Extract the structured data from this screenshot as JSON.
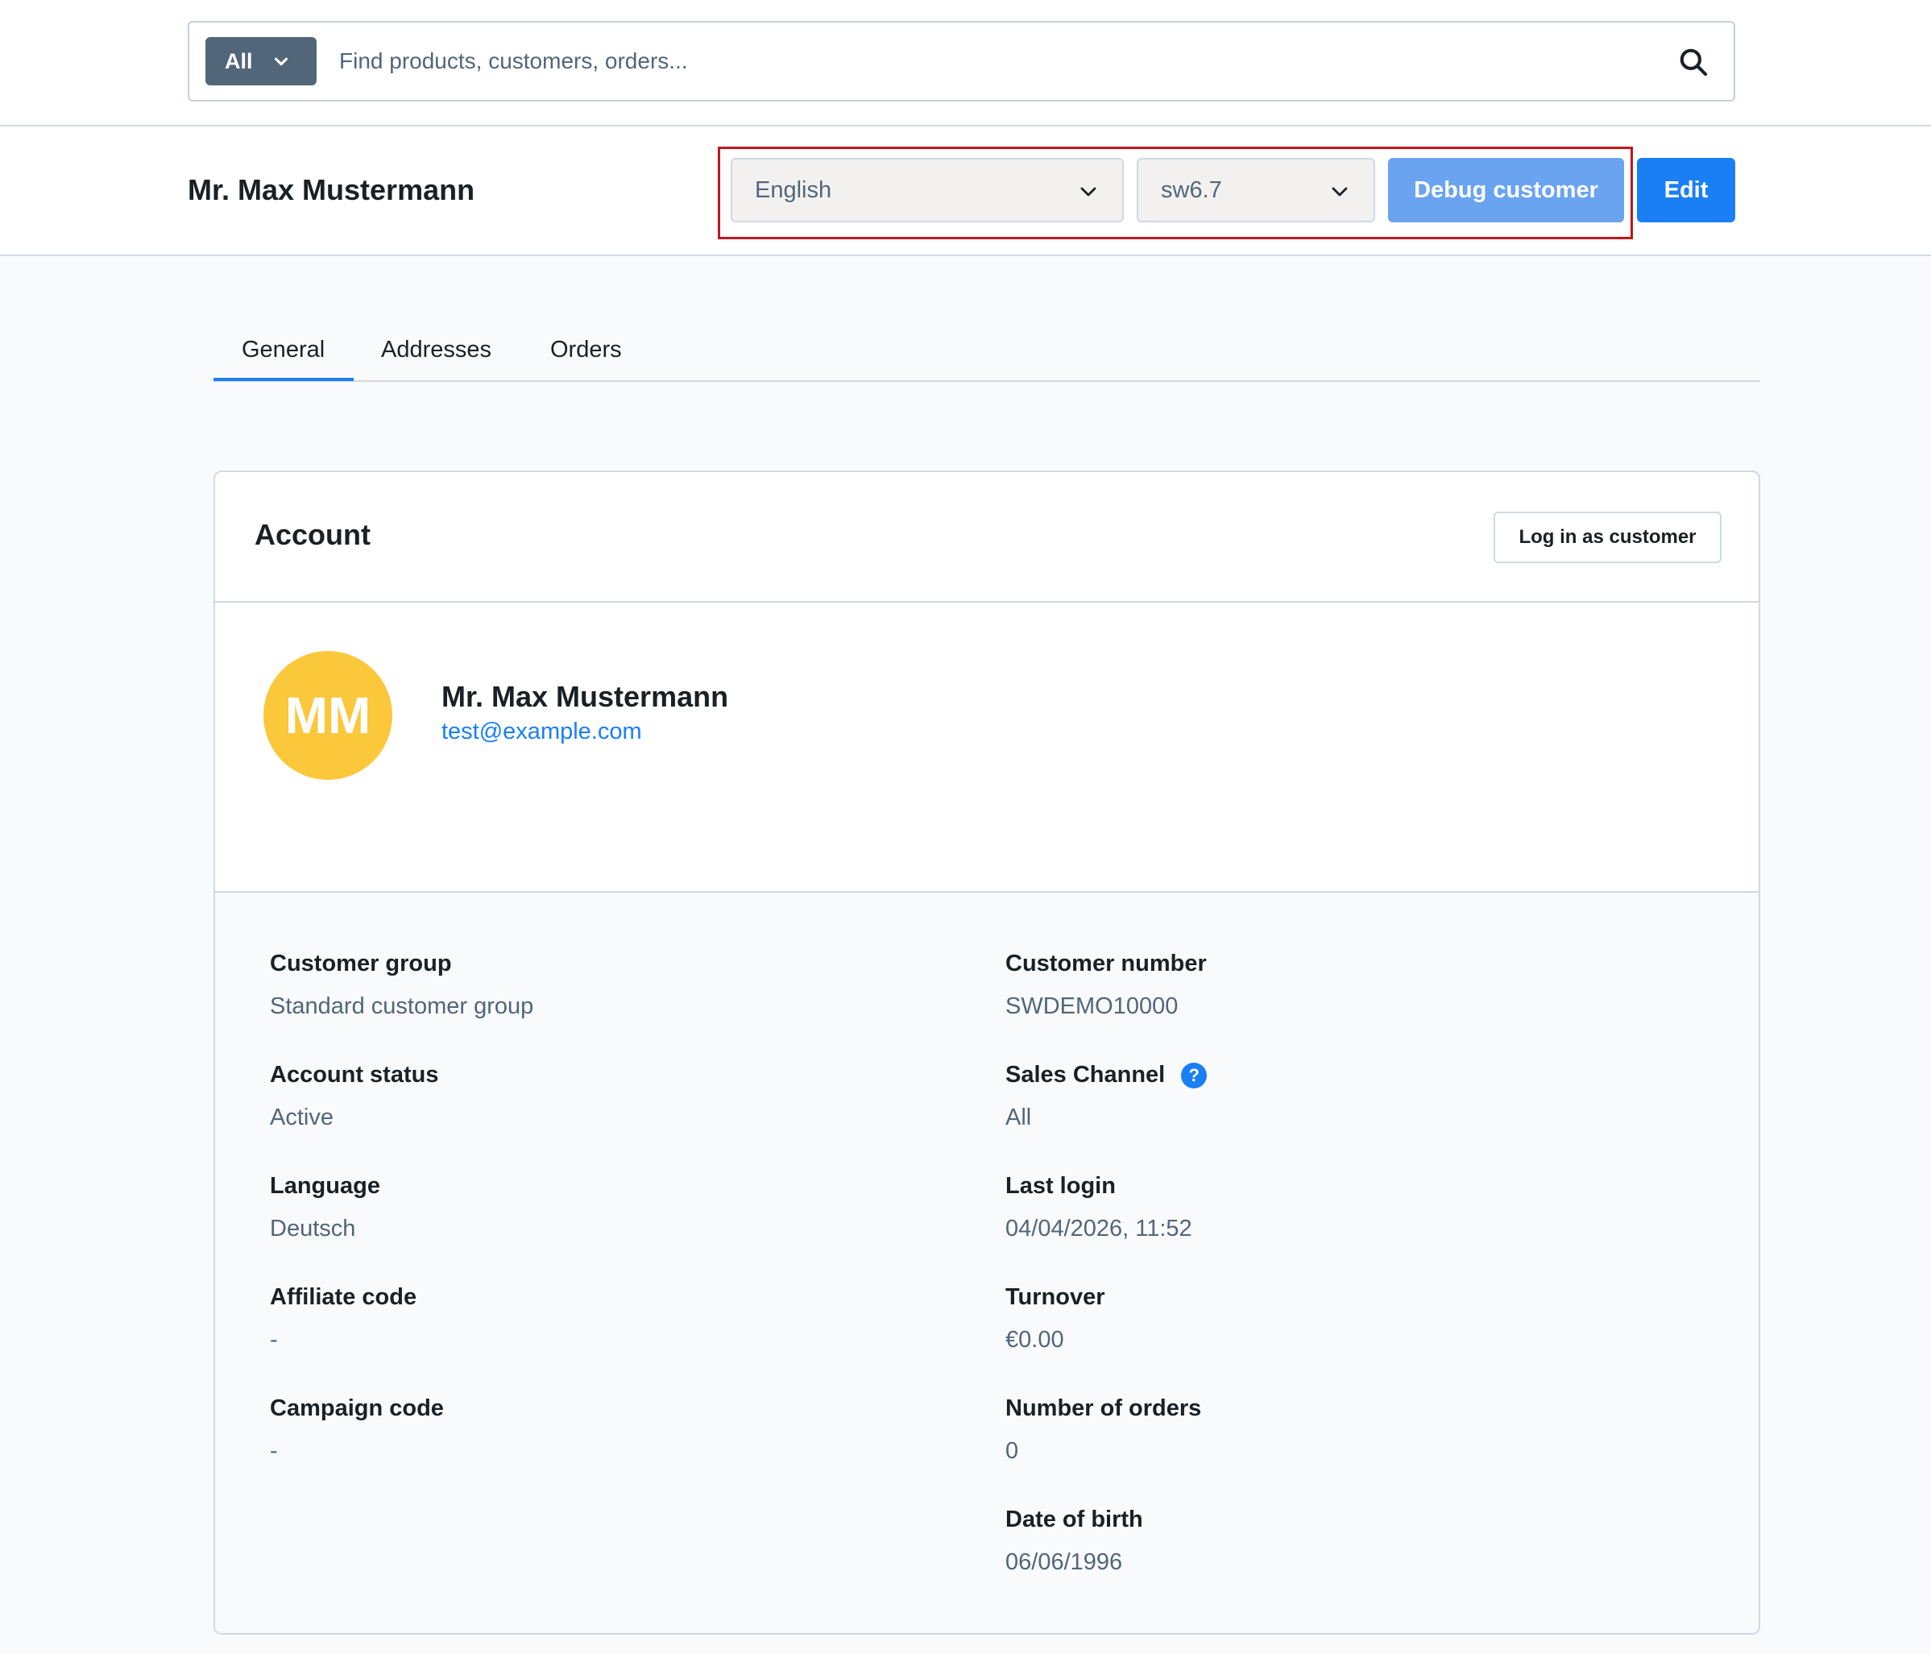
{
  "search": {
    "type_label": "All",
    "placeholder": "Find products, customers, orders..."
  },
  "header": {
    "title": "Mr. Max Mustermann",
    "language_select": "English",
    "version_select": "sw6.7",
    "debug_button": "Debug customer",
    "edit_button": "Edit"
  },
  "tabs": [
    {
      "label": "General",
      "active": true
    },
    {
      "label": "Addresses",
      "active": false
    },
    {
      "label": "Orders",
      "active": false
    }
  ],
  "account": {
    "title": "Account",
    "login_button": "Log in as customer",
    "avatar_initials": "MM",
    "avatar_color": "#fbc83c",
    "name": "Mr. Max Mustermann",
    "email": "test@example.com"
  },
  "fields_left": [
    {
      "label": "Customer group",
      "value": "Standard customer group"
    },
    {
      "label": "Account status",
      "value": "Active"
    },
    {
      "label": "Language",
      "value": "Deutsch"
    },
    {
      "label": "Affiliate code",
      "value": "-"
    },
    {
      "label": "Campaign code",
      "value": "-"
    }
  ],
  "fields_right": [
    {
      "label": "Customer number",
      "value": "SWDEMO10000"
    },
    {
      "label": "Sales Channel",
      "value": "All"
    },
    {
      "label": "Last login",
      "value": "04/04/2026, 11:52"
    },
    {
      "label": "Turnover",
      "value": "€0.00"
    },
    {
      "label": "Number of orders",
      "value": "0"
    },
    {
      "label": "Date of birth",
      "value": "06/06/1996"
    }
  ],
  "colors": {
    "primary": "#1a7ff5",
    "debug": "#6aa3f0",
    "highlight_border": "#c1161d"
  }
}
